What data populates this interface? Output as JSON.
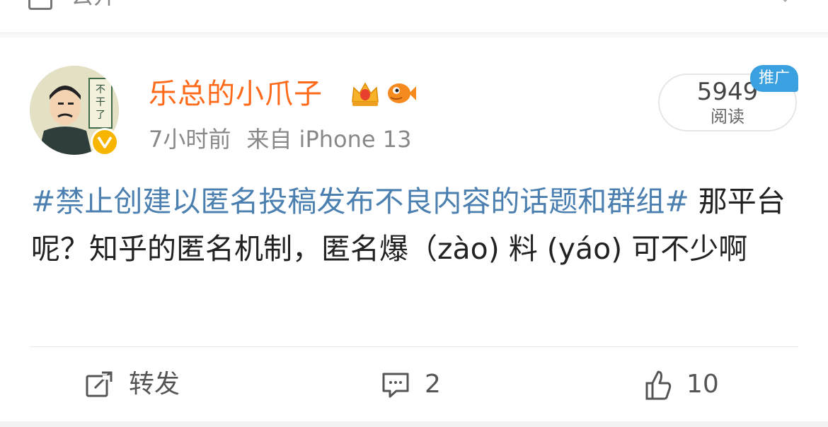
{
  "top": {
    "visibility_label": "公开"
  },
  "post": {
    "username": "乐总的小爪子",
    "time": "7小时前",
    "source": "来自 iPhone 13",
    "reads": {
      "count": "5949",
      "label": "阅读",
      "promo_tag": "推广"
    },
    "topic": "#禁止创建以匿名投稿发布不良内容的话题和群组#",
    "body": " 那平台呢？知乎的匿名机制，匿名爆（zào) 料 (yáo) 可不少啊",
    "avatar_text": "不干了"
  },
  "actions": {
    "repost_label": "转发",
    "comment_count": "2",
    "like_count": "10"
  },
  "colors": {
    "username": "#ff6a1a",
    "topic": "#4a7fb0",
    "promo": "#3aa0e0",
    "verified": "#f7b500"
  },
  "icons": [
    "public-icon",
    "verified-icon",
    "crown-badge-icon",
    "fish-badge-icon",
    "repost-icon",
    "comment-icon",
    "like-icon"
  ]
}
